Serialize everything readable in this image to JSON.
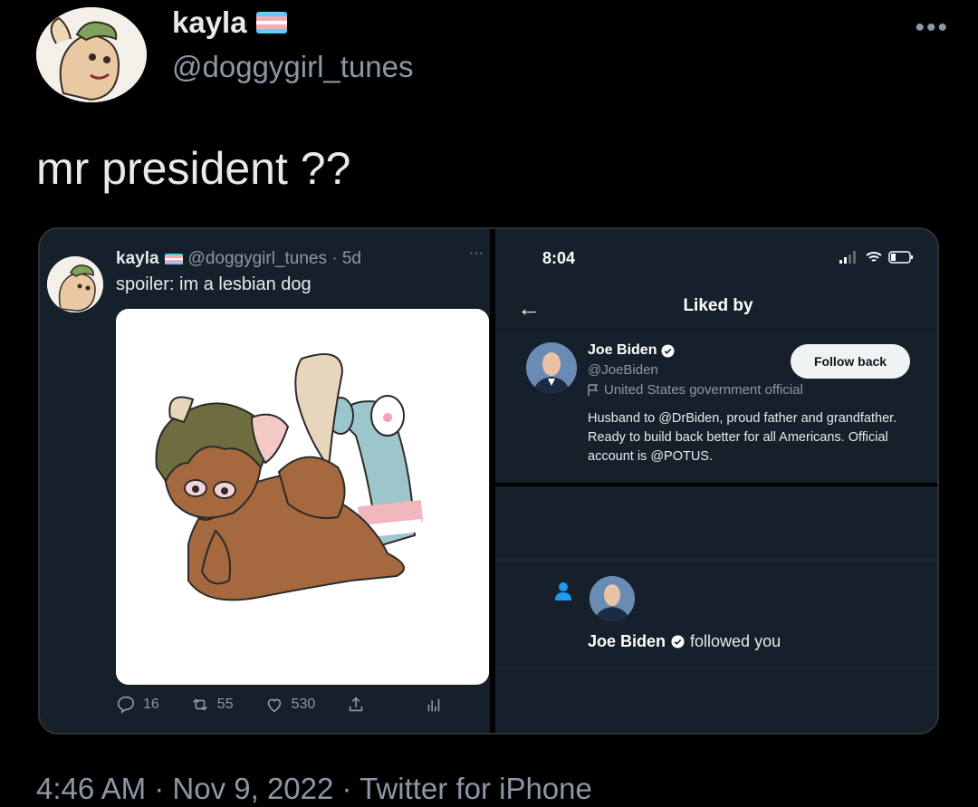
{
  "tweet": {
    "display_name": "kayla",
    "handle": "@doggygirl_tunes",
    "text": "mr president ??",
    "more_icon": "ellipsis-icon",
    "meta": "4:46 AM · Nov 9, 2022 · Twitter for iPhone",
    "flag_colors": [
      "#5bcefa",
      "#f5a9b8",
      "#ffffff",
      "#f5a9b8",
      "#5bcefa"
    ]
  },
  "embedded_left": {
    "name": "kayla",
    "handle_time": "@doggygirl_tunes · 5d",
    "more": "···",
    "text": "spoiler: im a lesbian dog",
    "actions": {
      "replies": "16",
      "retweets": "55",
      "likes": "530"
    }
  },
  "embedded_right": {
    "status_time": "8:04",
    "back_icon": "back-arrow-icon",
    "title": "Liked by",
    "user": {
      "name": "Joe Biden",
      "handle": "@JoeBiden",
      "label": "United States government official",
      "bio": "Husband to @DrBiden, proud father and grandfather. Ready to build back better for all Americans. Official account is @POTUS.",
      "button": "Follow back"
    },
    "notification": {
      "name": "Joe Biden",
      "action": "followed you"
    }
  }
}
